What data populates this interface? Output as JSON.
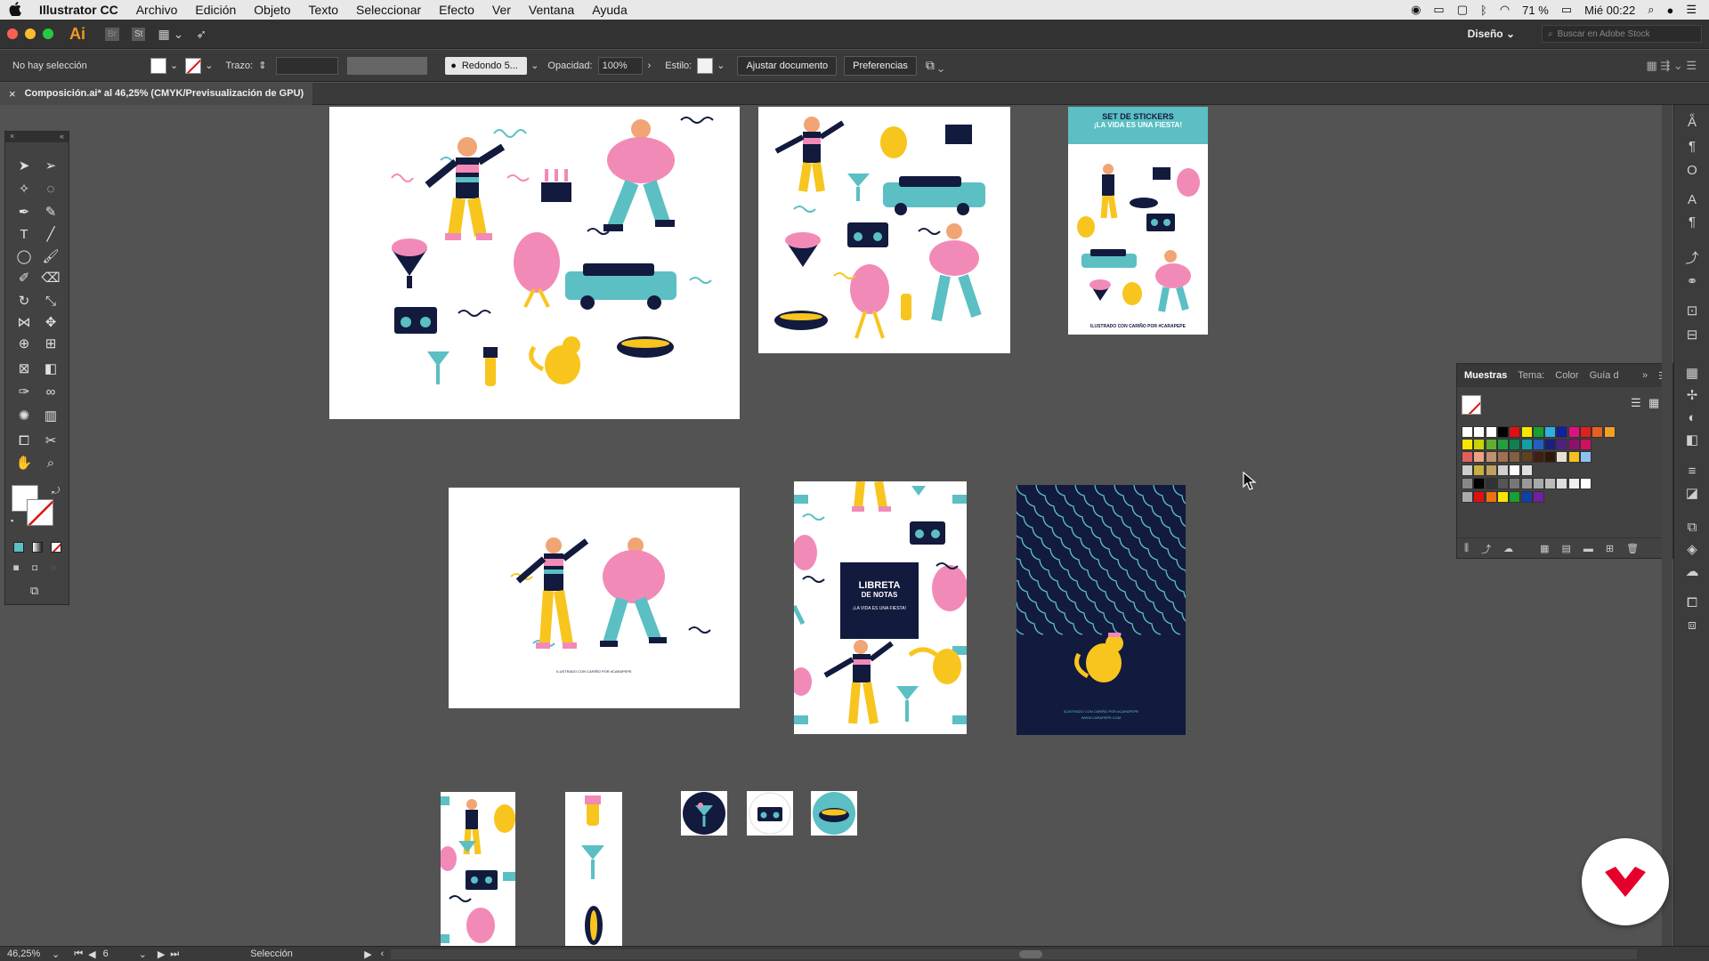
{
  "menubar": {
    "app_name": "Illustrator CC",
    "items": [
      "Archivo",
      "Edición",
      "Objeto",
      "Texto",
      "Seleccionar",
      "Efecto",
      "Ver",
      "Ventana",
      "Ayuda"
    ],
    "battery": "71 %",
    "clock": "Mié 00:22"
  },
  "titlebar": {
    "app_badge": "Ai",
    "br_badge": "Br",
    "st_badge": "St",
    "workspace": "Diseño",
    "search_placeholder": "Buscar en Adobe Stock"
  },
  "control_bar": {
    "selection_label": "No hay selección",
    "stroke_label": "Trazo:",
    "brush_value": "Redondo 5...",
    "opacity_label": "Opacidad:",
    "opacity_value": "100%",
    "style_label": "Estilo:",
    "fit_document_button": "Ajustar documento",
    "preferences_button": "Preferencias"
  },
  "document_tab": {
    "title": "Composición.ai* al 46,25% (CMYK/Previsualización de GPU)",
    "close": "×"
  },
  "artboards": {
    "stickers_title_line1": "SET DE STICKERS",
    "stickers_title_line2": "¡LA VIDA ES UNA FIESTA!",
    "stickers_footer": "ILUSTRADO CON CARIÑO POR #CARAPEPE",
    "small_footer": "ILUSTRADO CON CARIÑO POR #CARAPEPE",
    "notebook_title_line1": "LIBRETA",
    "notebook_title_line2": "DE NOTAS",
    "notebook_subtitle": "¡LA VIDA ES UNA FIESTA!",
    "dark_footer_line1": "ILUSTRADO CON CARIÑO POR #CARAPEPE",
    "dark_footer_line2": "WWW.CARAPEPE.COM"
  },
  "swatches_panel": {
    "tabs": [
      "Muestras",
      "Tema:",
      "Color",
      "Guía d"
    ]
  },
  "statusbar": {
    "zoom": "46,25%",
    "artboard_number": "6",
    "tool_name": "Selección"
  },
  "colors": {
    "pink": "#f28ab8",
    "yellow": "#f7c51e",
    "teal": "#5bbfc4",
    "navy": "#121a3d"
  }
}
